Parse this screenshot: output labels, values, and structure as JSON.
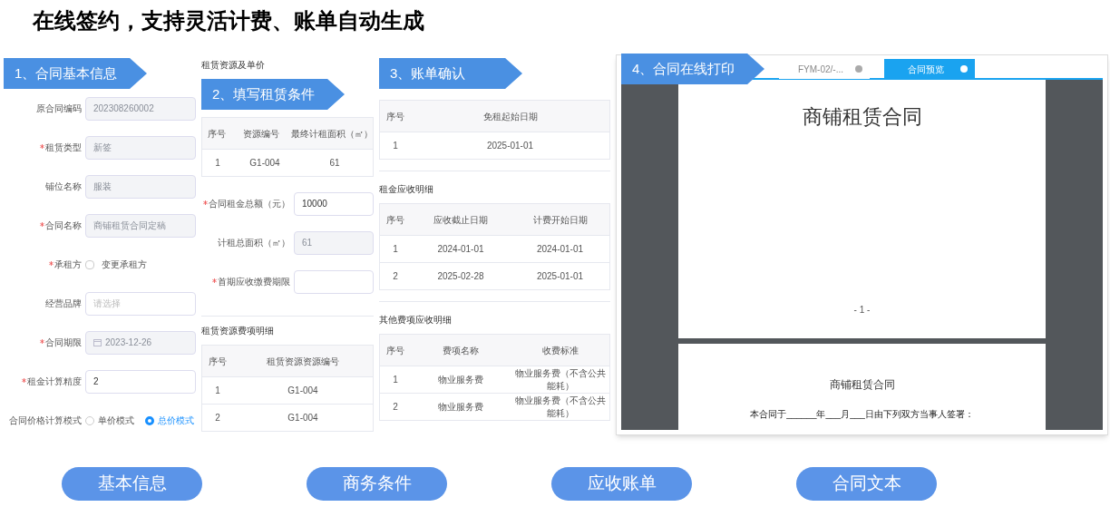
{
  "headline": "在线签约，支持灵活计费、账单自动生成",
  "panels": [
    {
      "kind": "form",
      "banner": "1、合同基本信息",
      "fields": [
        {
          "kind": "input",
          "label": "原合同编码",
          "required": false,
          "value": "202308260002",
          "disabled": true
        },
        {
          "kind": "input",
          "label": "租赁类型",
          "required": true,
          "value": "新签",
          "disabled": true
        },
        {
          "kind": "input",
          "label": "铺位名称",
          "required": false,
          "value": "服装",
          "disabled": true
        },
        {
          "kind": "input",
          "label": "合同名称",
          "required": true,
          "value": "商铺租赁合同定稿",
          "disabled": true
        },
        {
          "kind": "checkbox",
          "label": "承租方",
          "required": true,
          "option": "变更承租方",
          "checked": false
        },
        {
          "kind": "select",
          "label": "经营品牌",
          "required": false,
          "placeholder": "请选择"
        },
        {
          "kind": "date",
          "label": "合同期限",
          "required": true,
          "value": "2023-12-26",
          "disabled": true
        },
        {
          "kind": "input",
          "label": "租金计算精度",
          "required": true,
          "value": "2",
          "disabled": false
        },
        {
          "kind": "radio",
          "label": "合同价格计算模式",
          "required": false,
          "options": [
            {
              "label": "单价模式",
              "selected": false
            },
            {
              "label": "总价模式",
              "selected": true
            }
          ]
        }
      ]
    },
    {
      "kind": "terms",
      "banner": "2、填写租赁条件",
      "section": "租赁资源及单价",
      "table": {
        "columns": [
          "序号",
          "资源编号",
          "最终计租面积（㎡）"
        ],
        "rows": [
          [
            "1",
            "G1-004",
            "61"
          ]
        ]
      },
      "fields": [
        {
          "kind": "input",
          "label": "合同租金总额（元）",
          "required": true,
          "value": "10000",
          "disabled": false
        },
        {
          "kind": "input",
          "label": "计租总面积（㎡）",
          "required": false,
          "value": "61",
          "disabled": true
        },
        {
          "kind": "input",
          "label": "首期应收缴费期限",
          "required": true,
          "disabled": false
        }
      ],
      "section2": "租赁资源费项明细",
      "table2": {
        "columns": [
          "序号",
          "租赁资源资源编号"
        ],
        "rows": [
          [
            "1",
            "G1-004"
          ],
          [
            "2",
            "G1-004"
          ]
        ]
      }
    },
    {
      "kind": "bills",
      "banner": "3、账单确认",
      "tables": [
        {
          "columns": [
            "序号",
            "免租起始日期"
          ],
          "rows": [
            [
              "1",
              "2025-01-01"
            ]
          ]
        },
        {
          "title": "租金应收明细",
          "columns": [
            "序号",
            "应收截止日期",
            "计费开始日期"
          ],
          "rows": [
            [
              "1",
              "2024-01-01",
              "2024-01-01"
            ],
            [
              "2",
              "2025-02-28",
              "2025-01-01"
            ]
          ]
        },
        {
          "title": "其他费项应收明细",
          "columns": [
            "序号",
            "费项名称",
            "收费标准"
          ],
          "rows": [
            [
              "1",
              "物业服务费",
              "物业服务费（不含公共能耗）"
            ],
            [
              "2",
              "物业服务费",
              "物业服务费（不含公共能耗）"
            ]
          ]
        }
      ]
    },
    {
      "kind": "print",
      "banner": "4、合同在线打印",
      "tabs": [
        {
          "label": "FYM-02/-...",
          "selected": false
        },
        {
          "label": "合同预览",
          "selected": true
        }
      ],
      "page_title": "商铺租赁合同",
      "page_number": "- 1 -",
      "page2_title": "商铺租赁合同",
      "page2_text": "本合同于______年___月___日由下列双方当事人签署："
    }
  ],
  "pills": [
    "基本信息",
    "商务条件",
    "应收账单",
    "合同文本"
  ]
}
